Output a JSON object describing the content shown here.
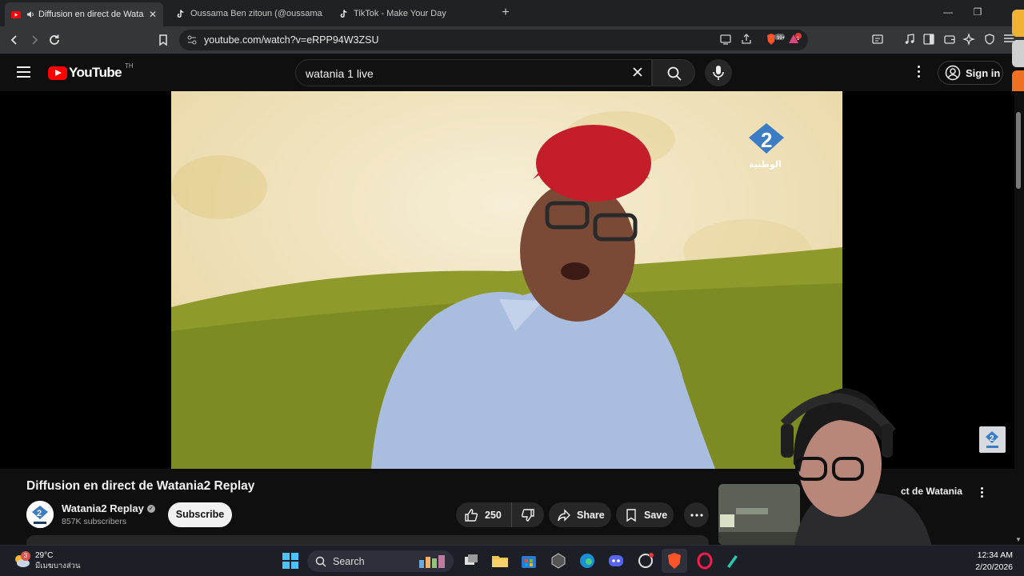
{
  "browser": {
    "tabs": [
      {
        "title": "Diffusion en direct de Watania",
        "active": true,
        "icon": "youtube-icon"
      },
      {
        "title": "Oussama Ben zitoun (@oussama.ben",
        "active": false,
        "icon": "tiktok-icon"
      },
      {
        "title": "TikTok - Make Your Day",
        "active": false,
        "icon": "tiktok-icon"
      }
    ],
    "url": "youtube.com/watch?v=eRPP94W3ZSU",
    "brave_badge": "99+",
    "alert_badge": "1"
  },
  "youtube": {
    "logo_text": "YouTube",
    "country_code": "TH",
    "search_value": "watania 1 live",
    "signin_label": "Sign in"
  },
  "video": {
    "title": "Diffusion en direct de Watania2 Replay",
    "watermark_text": "الوطنية",
    "channel_name": "Watania2 Replay",
    "subscribers": "857K subscribers",
    "subscribe_label": "Subscribe",
    "likes": "250",
    "share_label": "Share",
    "save_label": "Save"
  },
  "sidebar": {
    "next_title": "ct de Watania"
  },
  "taskbar": {
    "temperature": "29°C",
    "condition": "มีเมฆบางส่วน",
    "weather_badge": "3",
    "search_label": "Search",
    "time": "12:34 AM",
    "date": "2/20/2026"
  },
  "colors": {
    "youtube_red": "#ff0000",
    "background": "#0f0f0f",
    "chip": "#272727"
  }
}
